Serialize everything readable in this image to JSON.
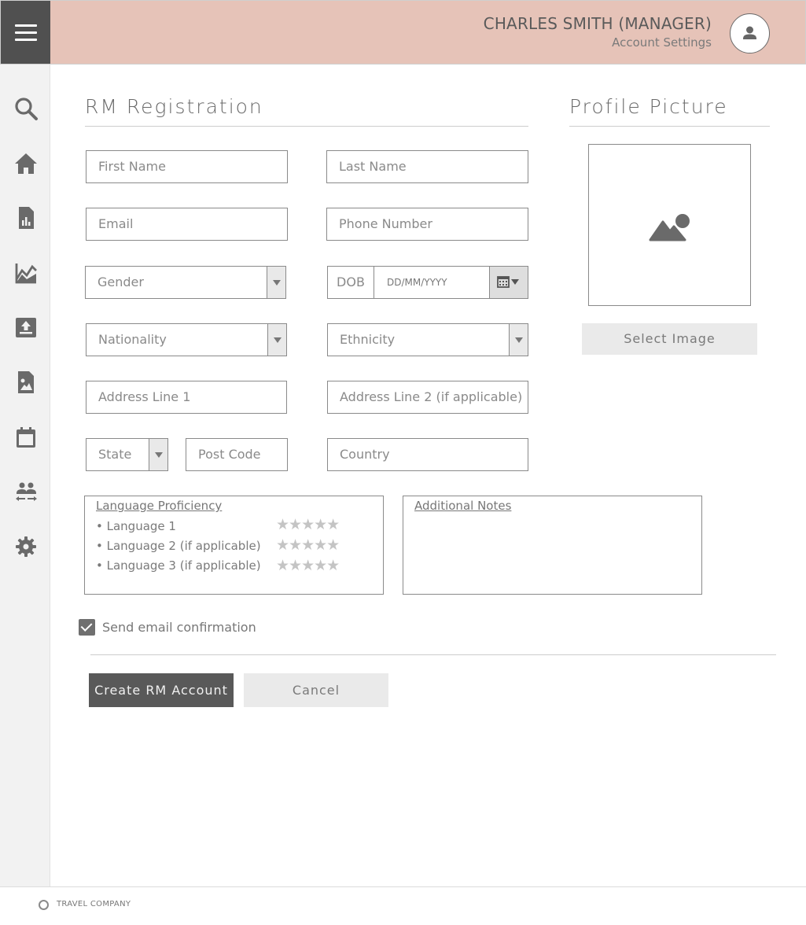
{
  "header": {
    "user_name": "CHARLES SMITH (MANAGER)",
    "account_link": "Account Settings",
    "menu_icon": "hamburger-icon",
    "avatar_icon": "user-icon",
    "background": "#e6c3b8"
  },
  "sidebar": {
    "items": [
      {
        "icon": "search-icon"
      },
      {
        "icon": "home-icon"
      },
      {
        "icon": "report-icon"
      },
      {
        "icon": "chart-icon"
      },
      {
        "icon": "upload-icon"
      },
      {
        "icon": "image-file-icon"
      },
      {
        "icon": "calendar-icon"
      },
      {
        "icon": "people-transfer-icon"
      },
      {
        "icon": "settings-icon"
      }
    ]
  },
  "form": {
    "title": "RM Registration",
    "first_name": "First Name",
    "last_name": "Last Name",
    "email": "Email",
    "phone": "Phone Number",
    "gender": "Gender",
    "dob_label": "DOB",
    "dob_placeholder": "DD/MM/YYYY",
    "nationality": "Nationality",
    "ethnicity": "Ethnicity",
    "address1": "Address Line 1",
    "address2": "Address Line 2 (if applicable)",
    "state": "State",
    "post_code": "Post Code",
    "country": "Country"
  },
  "profile": {
    "title": "Profile Picture",
    "select_button": "Select Image",
    "placeholder_icon": "image-placeholder-icon"
  },
  "languages": {
    "title": "Language Proficiency",
    "items": [
      {
        "label": "Language 1",
        "rating": "0/5"
      },
      {
        "label": "Language 2 (if applicable)",
        "rating": "0/5"
      },
      {
        "label": "Language 3 (if applicable)",
        "rating": "0/5"
      }
    ]
  },
  "notes": {
    "title": "Additional Notes"
  },
  "confirmation": {
    "label": "Send email confirmation",
    "checked": true
  },
  "actions": {
    "create": "Create RM Account",
    "cancel": "Cancel"
  },
  "footer": {
    "text": "TRAVEL COMPANY",
    "icon": "copyright-icon"
  }
}
